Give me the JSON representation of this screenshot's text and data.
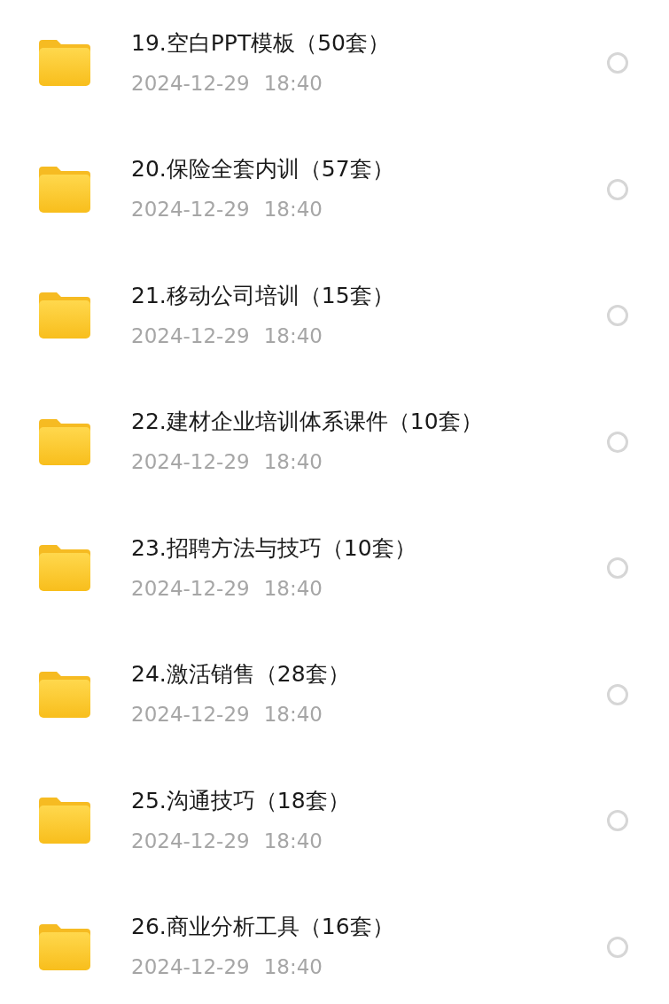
{
  "files": [
    {
      "name": "19.空白PPT模板（50套）",
      "date": "2024-12-29",
      "time": "18:40",
      "selected": false
    },
    {
      "name": "20.保险全套内训（57套）",
      "date": "2024-12-29",
      "time": "18:40",
      "selected": false
    },
    {
      "name": "21.移动公司培训（15套）",
      "date": "2024-12-29",
      "time": "18:40",
      "selected": false
    },
    {
      "name": "22.建材企业培训体系课件（10套）",
      "date": "2024-12-29",
      "time": "18:40",
      "selected": false
    },
    {
      "name": "23.招聘方法与技巧（10套）",
      "date": "2024-12-29",
      "time": "18:40",
      "selected": false
    },
    {
      "name": "24.激活销售（28套）",
      "date": "2024-12-29",
      "time": "18:40",
      "selected": false
    },
    {
      "name": "25.沟通技巧（18套）",
      "date": "2024-12-29",
      "time": "18:40",
      "selected": false
    },
    {
      "name": "26.商业分析工具（16套）",
      "date": "2024-12-29",
      "time": "18:40",
      "selected": false
    }
  ]
}
